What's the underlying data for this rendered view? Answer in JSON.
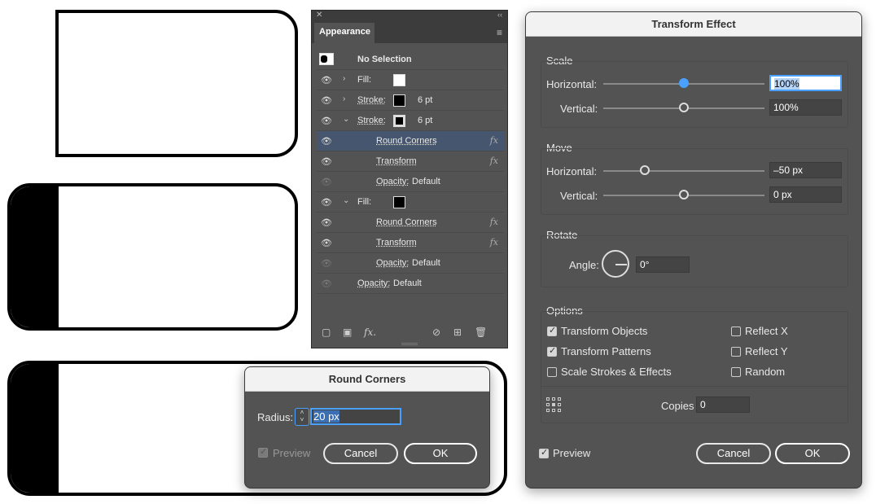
{
  "appearance": {
    "tab_label": "Appearance",
    "close_glyph": "✕",
    "collapse_glyph": "‹‹",
    "menu_glyph": "≡",
    "rows": {
      "no_selection": "No Selection",
      "fill1_label": "Fill:",
      "stroke1_label": "Stroke:",
      "stroke1_value": "6 pt",
      "stroke2_label": "Stroke:",
      "stroke2_value": "6 pt",
      "round_corners1": "Round Corners",
      "transform1": "Transform",
      "opacity1_label": "Opacity:",
      "opacity1_value": "Default",
      "fill2_label": "Fill:",
      "round_corners2": "Round Corners",
      "transform2": "Transform",
      "opacity2_label": "Opacity:",
      "opacity2_value": "Default",
      "opacity3_label": "Opacity:",
      "opacity3_value": "Default"
    },
    "fx_glyph": "fx"
  },
  "round_corners_dialog": {
    "title": "Round Corners",
    "radius_label": "Radius:",
    "radius_value": "20 px",
    "preview_label": "Preview",
    "cancel_label": "Cancel",
    "ok_label": "OK"
  },
  "transform_dialog": {
    "title": "Transform Effect",
    "scale_label": "Scale",
    "scale_h_label": "Horizontal:",
    "scale_h_value": "100%",
    "scale_v_label": "Vertical:",
    "scale_v_value": "100%",
    "move_label": "Move",
    "move_h_label": "Horizontal:",
    "move_h_value": "–50 px",
    "move_v_label": "Vertical:",
    "move_v_value": "0 px",
    "rotate_label": "Rotate",
    "angle_label": "Angle:",
    "angle_value": "0°",
    "options_label": "Options",
    "transform_objects": "Transform Objects",
    "transform_patterns": "Transform Patterns",
    "scale_strokes": "Scale Strokes & Effects",
    "reflect_x": "Reflect X",
    "reflect_y": "Reflect Y",
    "random": "Random",
    "copies_label": "Copies",
    "copies_value": "0",
    "preview_label": "Preview",
    "cancel_label": "Cancel",
    "ok_label": "OK"
  },
  "colors": {
    "panel_bg": "#535353",
    "accent": "#4aa0ff",
    "selected_row": "#46566e"
  }
}
